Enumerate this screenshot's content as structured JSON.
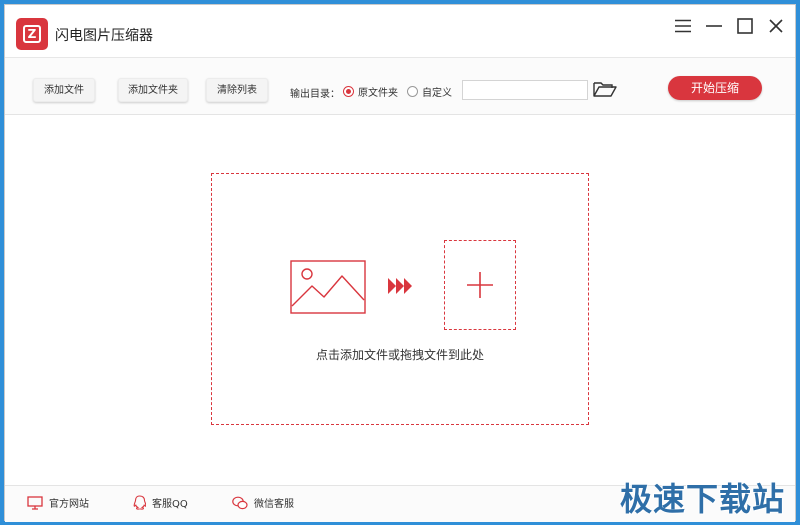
{
  "app": {
    "title": "闪电图片压缩器",
    "accent_color": "#d9363e"
  },
  "window_controls": {
    "menu": "menu-icon",
    "minimize": "minimize-icon",
    "maximize": "maximize-icon",
    "close": "close-icon"
  },
  "toolbar": {
    "add_file_label": "添加文件",
    "add_folder_label": "添加文件夹",
    "clear_list_label": "清除列表",
    "output_dir_label": "输出目录：",
    "output_options": [
      {
        "label": "原文件夹",
        "selected": true
      },
      {
        "label": "自定义",
        "selected": false
      }
    ],
    "path_input_value": "",
    "start_label": "开始压缩"
  },
  "main": {
    "drop_hint": "点击添加文件或拖拽文件到此处"
  },
  "footer": {
    "links": [
      {
        "label": "官方网站",
        "icon": "monitor-icon"
      },
      {
        "label": "客服QQ",
        "icon": "qq-icon"
      },
      {
        "label": "微信客服",
        "icon": "wechat-icon"
      }
    ]
  },
  "watermark": "极速下载站"
}
